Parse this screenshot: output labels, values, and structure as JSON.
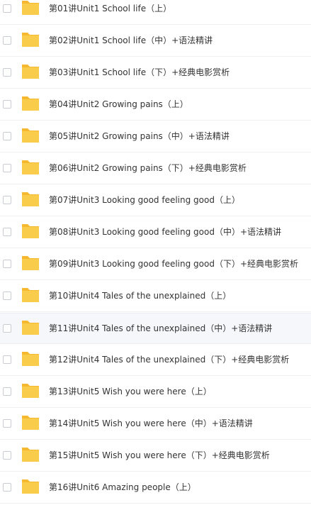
{
  "colors": {
    "folder": "#f9cd4b",
    "folder_tab": "#f5b82f",
    "text": "#333333",
    "row_divider": "#eef0f3",
    "hover_bg": "#f5f7fa"
  },
  "items": [
    {
      "label": "第01讲Unit1 School life（上）",
      "icon": "folder-icon"
    },
    {
      "label": "第02讲Unit1 School life（中）+语法精讲",
      "icon": "folder-icon"
    },
    {
      "label": "第03讲Unit1 School life（下）+经典电影赏析",
      "icon": "folder-icon"
    },
    {
      "label": "第04讲Unit2 Growing pains（上）",
      "icon": "folder-icon"
    },
    {
      "label": "第05讲Unit2 Growing pains（中）+语法精讲",
      "icon": "folder-icon"
    },
    {
      "label": "第06讲Unit2 Growing pains（下）+经典电影赏析",
      "icon": "folder-icon"
    },
    {
      "label": "第07讲Unit3 Looking good feeling good（上）",
      "icon": "folder-icon"
    },
    {
      "label": "第08讲Unit3 Looking good feeling good（中）+语法精讲",
      "icon": "folder-icon"
    },
    {
      "label": "第09讲Unit3 Looking good feeling good（下）+经典电影赏析",
      "icon": "folder-icon"
    },
    {
      "label": "第10讲Unit4 Tales of the unexplained（上）",
      "icon": "folder-icon"
    },
    {
      "label": "第11讲Unit4 Tales of the unexplained（中）+语法精讲",
      "icon": "folder-icon",
      "hover": true
    },
    {
      "label": "第12讲Unit4 Tales of the unexplained（下）+经典电影赏析",
      "icon": "folder-icon"
    },
    {
      "label": "第13讲Unit5 Wish you were here（上）",
      "icon": "folder-icon"
    },
    {
      "label": "第14讲Unit5 Wish you were here（中）+语法精讲",
      "icon": "folder-icon"
    },
    {
      "label": "第15讲Unit5 Wish you were here（下）+经典电影赏析",
      "icon": "folder-icon"
    },
    {
      "label": "第16讲Unit6 Amazing people（上）",
      "icon": "folder-icon"
    }
  ]
}
